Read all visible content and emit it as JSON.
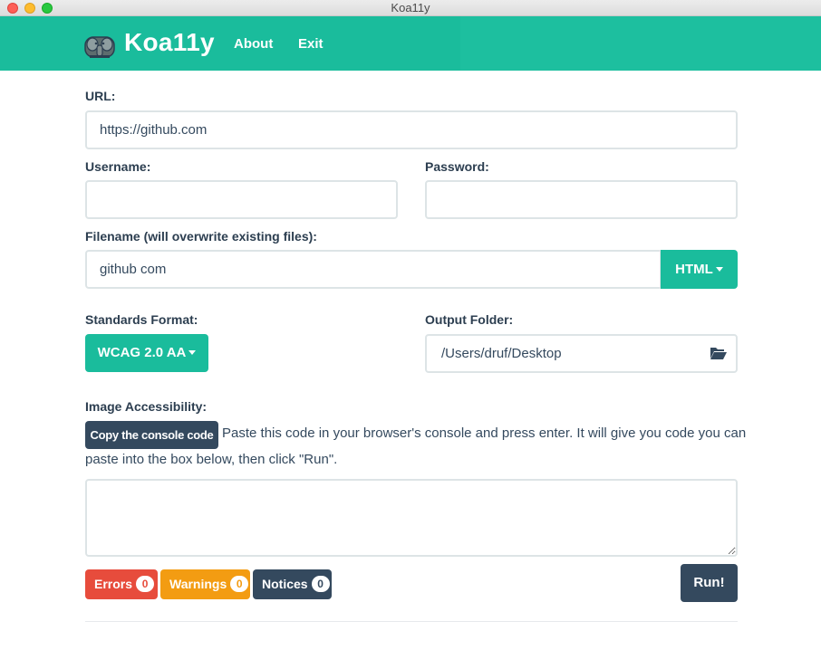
{
  "window": {
    "title": "Koa11y"
  },
  "navbar": {
    "brand": "Koa11y",
    "logo_icon": "elephant-logo-icon",
    "links": [
      "About",
      "Exit"
    ],
    "color": "#1abc9c"
  },
  "form": {
    "url": {
      "label": "URL:",
      "value": "https://github.com"
    },
    "username": {
      "label": "Username:",
      "value": ""
    },
    "password": {
      "label": "Password:",
      "value": ""
    },
    "filename": {
      "label": "Filename (will overwrite existing files):",
      "value": "github com",
      "format_button": "HTML"
    },
    "standards": {
      "label": "Standards Format:",
      "selected": "WCAG 2.0 AA"
    },
    "output_folder": {
      "label": "Output Folder:",
      "value": "/Users/druf/Desktop",
      "icon": "folder-open-icon"
    },
    "image_accessibility": {
      "label": "Image Accessibility:",
      "copy_button": "Copy the console code",
      "instructions_line1": "Paste this code in your browser's console and press enter. It will give you code you can",
      "instructions_line2": "paste into the box below, then click \"Run\".",
      "textarea_value": ""
    }
  },
  "results": {
    "errors": {
      "label": "Errors",
      "count": "0",
      "color": "#e74c3c"
    },
    "warnings": {
      "label": "Warnings",
      "count": "0",
      "color": "#f39c12"
    },
    "notices": {
      "label": "Notices",
      "count": "0",
      "color": "#34495e"
    }
  },
  "run_button": "Run!"
}
